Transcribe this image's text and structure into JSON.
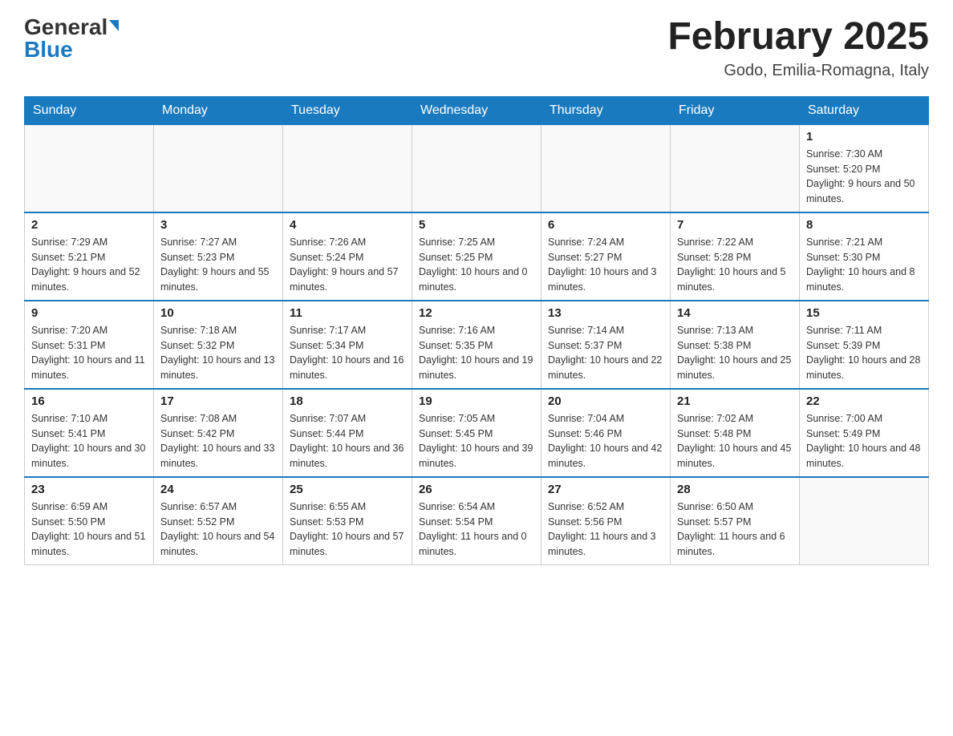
{
  "header": {
    "logo_general": "General",
    "logo_blue": "Blue",
    "month_title": "February 2025",
    "location": "Godo, Emilia-Romagna, Italy"
  },
  "weekdays": [
    "Sunday",
    "Monday",
    "Tuesday",
    "Wednesday",
    "Thursday",
    "Friday",
    "Saturday"
  ],
  "weeks": [
    [
      {
        "day": "",
        "info": ""
      },
      {
        "day": "",
        "info": ""
      },
      {
        "day": "",
        "info": ""
      },
      {
        "day": "",
        "info": ""
      },
      {
        "day": "",
        "info": ""
      },
      {
        "day": "",
        "info": ""
      },
      {
        "day": "1",
        "info": "Sunrise: 7:30 AM\nSunset: 5:20 PM\nDaylight: 9 hours and 50 minutes."
      }
    ],
    [
      {
        "day": "2",
        "info": "Sunrise: 7:29 AM\nSunset: 5:21 PM\nDaylight: 9 hours and 52 minutes."
      },
      {
        "day": "3",
        "info": "Sunrise: 7:27 AM\nSunset: 5:23 PM\nDaylight: 9 hours and 55 minutes."
      },
      {
        "day": "4",
        "info": "Sunrise: 7:26 AM\nSunset: 5:24 PM\nDaylight: 9 hours and 57 minutes."
      },
      {
        "day": "5",
        "info": "Sunrise: 7:25 AM\nSunset: 5:25 PM\nDaylight: 10 hours and 0 minutes."
      },
      {
        "day": "6",
        "info": "Sunrise: 7:24 AM\nSunset: 5:27 PM\nDaylight: 10 hours and 3 minutes."
      },
      {
        "day": "7",
        "info": "Sunrise: 7:22 AM\nSunset: 5:28 PM\nDaylight: 10 hours and 5 minutes."
      },
      {
        "day": "8",
        "info": "Sunrise: 7:21 AM\nSunset: 5:30 PM\nDaylight: 10 hours and 8 minutes."
      }
    ],
    [
      {
        "day": "9",
        "info": "Sunrise: 7:20 AM\nSunset: 5:31 PM\nDaylight: 10 hours and 11 minutes."
      },
      {
        "day": "10",
        "info": "Sunrise: 7:18 AM\nSunset: 5:32 PM\nDaylight: 10 hours and 13 minutes."
      },
      {
        "day": "11",
        "info": "Sunrise: 7:17 AM\nSunset: 5:34 PM\nDaylight: 10 hours and 16 minutes."
      },
      {
        "day": "12",
        "info": "Sunrise: 7:16 AM\nSunset: 5:35 PM\nDaylight: 10 hours and 19 minutes."
      },
      {
        "day": "13",
        "info": "Sunrise: 7:14 AM\nSunset: 5:37 PM\nDaylight: 10 hours and 22 minutes."
      },
      {
        "day": "14",
        "info": "Sunrise: 7:13 AM\nSunset: 5:38 PM\nDaylight: 10 hours and 25 minutes."
      },
      {
        "day": "15",
        "info": "Sunrise: 7:11 AM\nSunset: 5:39 PM\nDaylight: 10 hours and 28 minutes."
      }
    ],
    [
      {
        "day": "16",
        "info": "Sunrise: 7:10 AM\nSunset: 5:41 PM\nDaylight: 10 hours and 30 minutes."
      },
      {
        "day": "17",
        "info": "Sunrise: 7:08 AM\nSunset: 5:42 PM\nDaylight: 10 hours and 33 minutes."
      },
      {
        "day": "18",
        "info": "Sunrise: 7:07 AM\nSunset: 5:44 PM\nDaylight: 10 hours and 36 minutes."
      },
      {
        "day": "19",
        "info": "Sunrise: 7:05 AM\nSunset: 5:45 PM\nDaylight: 10 hours and 39 minutes."
      },
      {
        "day": "20",
        "info": "Sunrise: 7:04 AM\nSunset: 5:46 PM\nDaylight: 10 hours and 42 minutes."
      },
      {
        "day": "21",
        "info": "Sunrise: 7:02 AM\nSunset: 5:48 PM\nDaylight: 10 hours and 45 minutes."
      },
      {
        "day": "22",
        "info": "Sunrise: 7:00 AM\nSunset: 5:49 PM\nDaylight: 10 hours and 48 minutes."
      }
    ],
    [
      {
        "day": "23",
        "info": "Sunrise: 6:59 AM\nSunset: 5:50 PM\nDaylight: 10 hours and 51 minutes."
      },
      {
        "day": "24",
        "info": "Sunrise: 6:57 AM\nSunset: 5:52 PM\nDaylight: 10 hours and 54 minutes."
      },
      {
        "day": "25",
        "info": "Sunrise: 6:55 AM\nSunset: 5:53 PM\nDaylight: 10 hours and 57 minutes."
      },
      {
        "day": "26",
        "info": "Sunrise: 6:54 AM\nSunset: 5:54 PM\nDaylight: 11 hours and 0 minutes."
      },
      {
        "day": "27",
        "info": "Sunrise: 6:52 AM\nSunset: 5:56 PM\nDaylight: 11 hours and 3 minutes."
      },
      {
        "day": "28",
        "info": "Sunrise: 6:50 AM\nSunset: 5:57 PM\nDaylight: 11 hours and 6 minutes."
      },
      {
        "day": "",
        "info": ""
      }
    ]
  ]
}
